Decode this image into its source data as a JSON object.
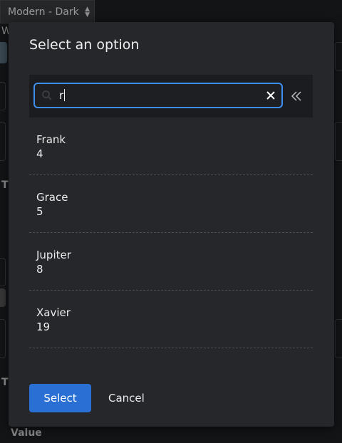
{
  "background": {
    "theme_select": {
      "label": "Modern - Dark"
    },
    "value_label": "Value",
    "fragments": [
      "W",
      "T",
      "T"
    ]
  },
  "dialog": {
    "title": "Select an option",
    "search": {
      "value": "r",
      "clear_icon": "close-icon",
      "collapse_icon": "double-chevron-left-icon"
    },
    "options": [
      {
        "name": "Frank",
        "value": "4"
      },
      {
        "name": "Grace",
        "value": "5"
      },
      {
        "name": "Jupiter",
        "value": "8"
      },
      {
        "name": "Xavier",
        "value": "19"
      }
    ],
    "select_label": "Select",
    "cancel_label": "Cancel"
  },
  "colors": {
    "accent": "#3f8ff0",
    "primary_button": "#2a6fd3",
    "dialog_bg": "#26272b"
  }
}
